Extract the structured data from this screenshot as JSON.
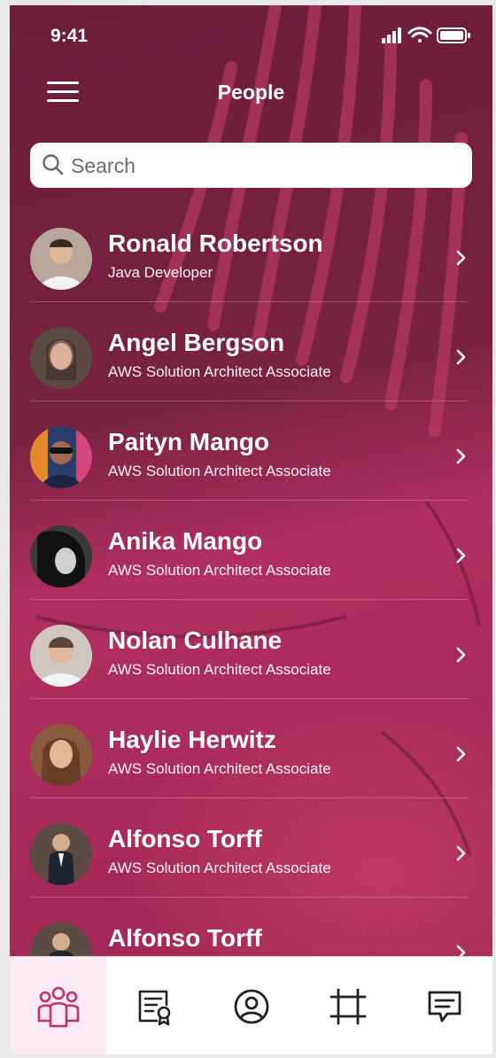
{
  "status": {
    "time": "9:41"
  },
  "header": {
    "title": "People",
    "menu_icon": "hamburger-menu-icon"
  },
  "search": {
    "placeholder": "Search",
    "value": "",
    "icon": "search-icon"
  },
  "people": [
    {
      "name": "Ronald Robertson",
      "role": "Java Developer",
      "avatar_color": "#b8a69a"
    },
    {
      "name": "Angel Bergson",
      "role": "AWS Solution Architect Associate",
      "avatar_color": "#5a4a42"
    },
    {
      "name": "Paityn Mango",
      "role": "AWS Solution Architect Associate",
      "avatar_color": "#2b3e6b"
    },
    {
      "name": "Anika Mango",
      "role": "AWS Solution Architect Associate",
      "avatar_color": "#3a3a3a"
    },
    {
      "name": "Nolan Culhane",
      "role": "AWS Solution Architect Associate",
      "avatar_color": "#cfc6c0"
    },
    {
      "name": "Haylie Herwitz",
      "role": "AWS Solution Architect Associate",
      "avatar_color": "#8a5a3e"
    },
    {
      "name": "Alfonso Torff",
      "role": "AWS Solution Architect Associate",
      "avatar_color": "#5c4a44"
    },
    {
      "name": "Alfonso Torff",
      "role": "",
      "avatar_color": "#5c4a44"
    }
  ],
  "tabs": [
    {
      "icon": "people-group-icon",
      "active": true
    },
    {
      "icon": "certificate-document-icon",
      "active": false
    },
    {
      "icon": "profile-circle-icon",
      "active": false
    },
    {
      "icon": "frame-crop-icon",
      "active": false
    },
    {
      "icon": "chat-message-icon",
      "active": false
    }
  ],
  "colors": {
    "accent": "#c0306a",
    "background": "#6e1f3c",
    "tab_active_bg": "#fbeaf1"
  }
}
